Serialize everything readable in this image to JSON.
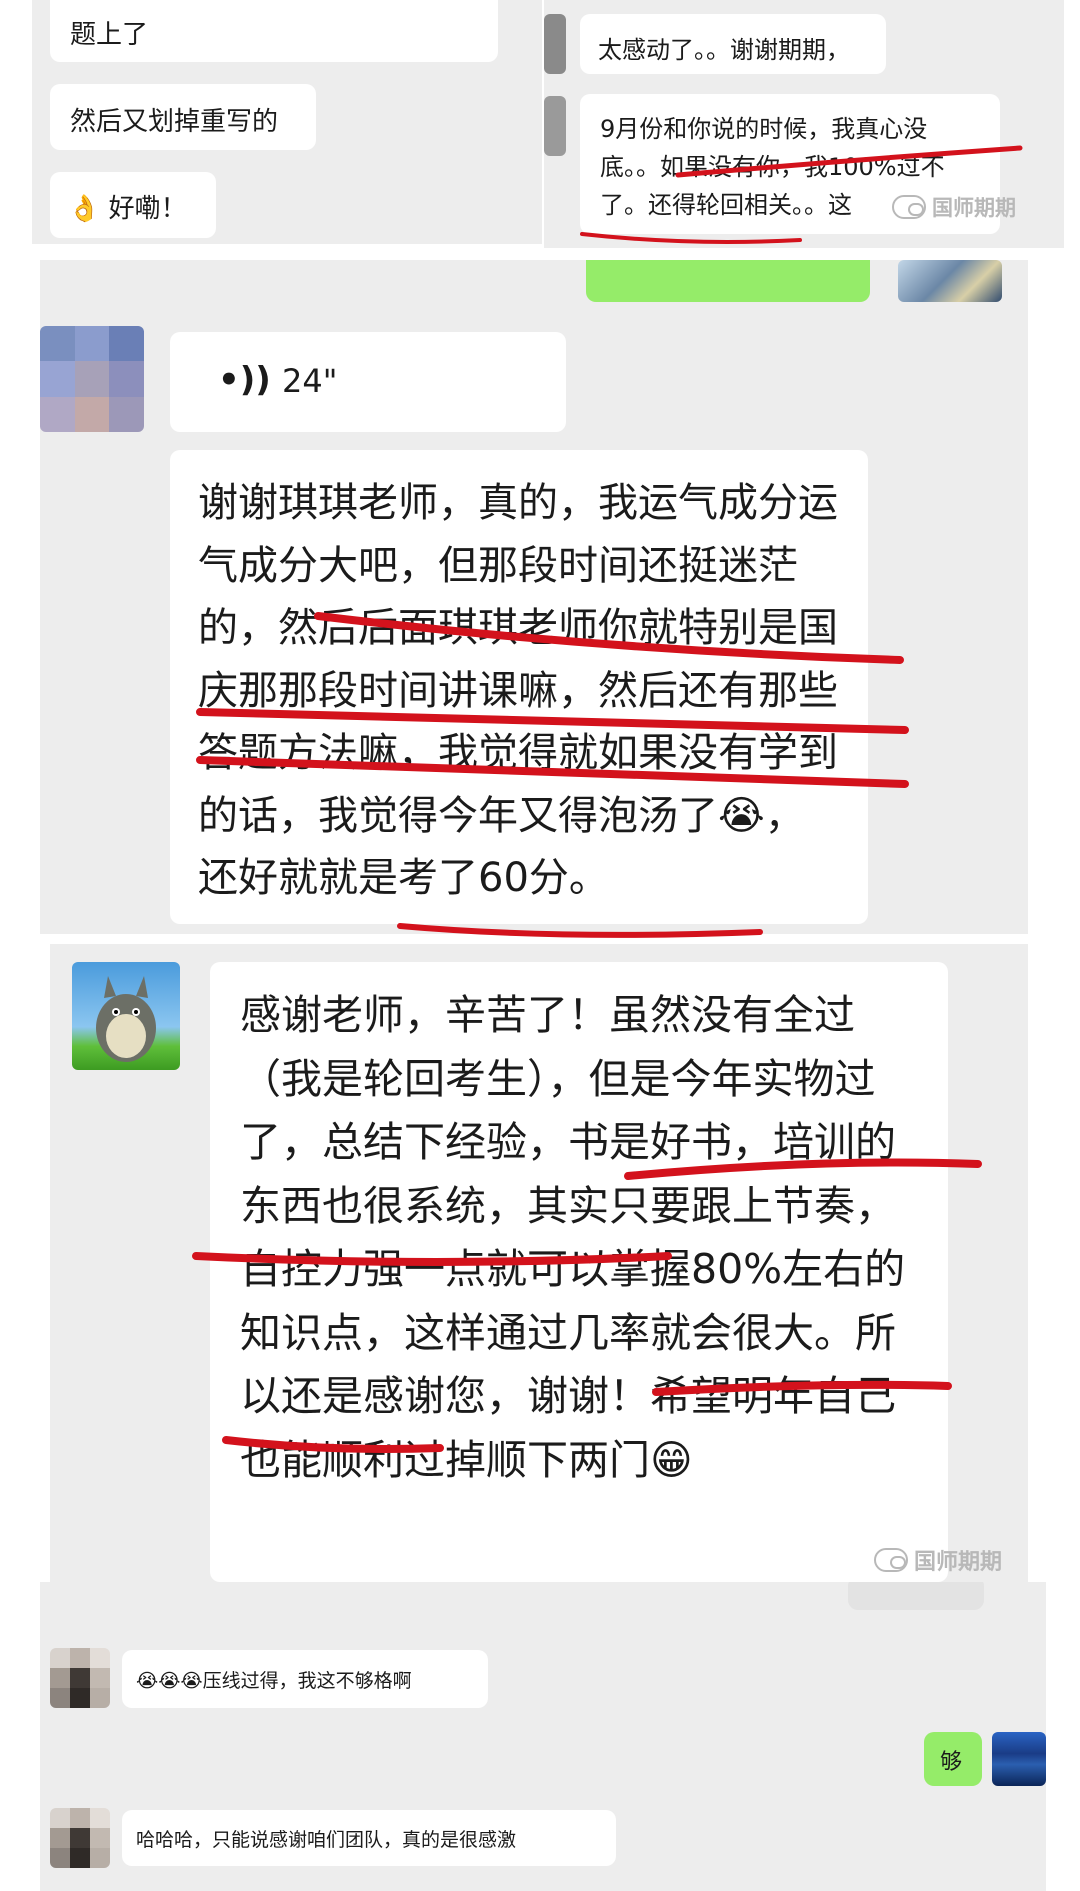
{
  "top_left": {
    "messages": [
      "题上了",
      "然后又划掉重写的",
      "好嘞！"
    ],
    "emoji": "👌"
  },
  "top_right": {
    "messages": [
      "太感动了。。谢谢期期，",
      "9月份和你说的时候，我真心没底。。如果没有你，我100%过不了。还得轮回相关。。这"
    ],
    "watermark": "国师期期"
  },
  "middle": {
    "voice_duration": "24\"",
    "long_message": "谢谢琪琪老师，真的，我运气成分运气成分大吧，但那段时间还挺迷茫的，然后后面琪琪老师你就特别是国庆那那段时间讲课嘛，然后还有那些答题方法嘛，我觉得就如果没有学到的话，我觉得今年又得泡汤了😭，还好就就是考了60分。"
  },
  "totoro_chat": {
    "message": "感谢老师，辛苦了！虽然没有全过（我是轮回考生），但是今年实物过了，总结下经验，书是好书，培训的东西也很系统，其实只要跟上节奏，自控力强一点就可以掌握80%左右的知识点，这样通过几率就会很大。所以还是感谢您，谢谢！希望明年自己也能顺利过掉顺下两门😁",
    "watermark": "国师期期"
  },
  "bottom": {
    "msg1": "压线过得，我这不够格啊",
    "msg1_emojis": "😭😭😭",
    "reply": "够",
    "msg2": "哈哈哈，只能说感谢咱们团队，真的是很感激"
  },
  "colors": {
    "chat_bg": "#ededed",
    "bubble": "#ffffff",
    "green_bubble": "#95ec69",
    "underline": "#d3121c"
  }
}
